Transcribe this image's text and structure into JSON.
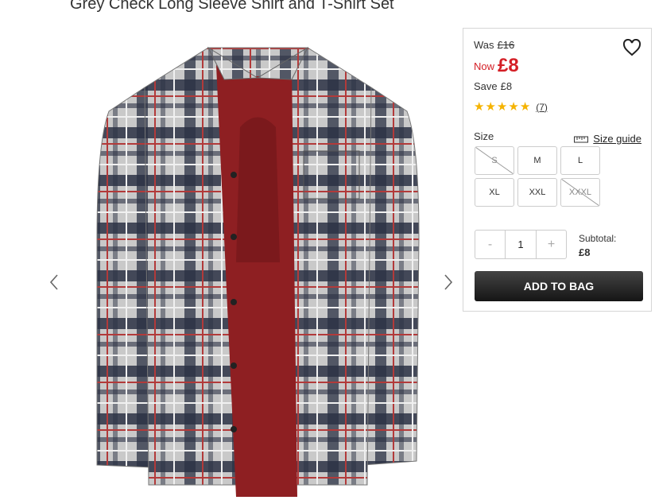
{
  "product": {
    "title": "Grey Check Long Sleeve Shirt and T-Shirt Set"
  },
  "gallery": {
    "prev_icon": "chevron-left-icon",
    "next_icon": "chevron-right-icon"
  },
  "price": {
    "was_label": "Was",
    "was_value": "£16",
    "now_label": "Now",
    "now_value": "£8",
    "save_label": "Save",
    "save_value": "£8",
    "accent_color": "#d41f26"
  },
  "rating": {
    "stars": 5,
    "max": 5,
    "reviews": "(7)",
    "star_color": "#f5b300"
  },
  "size": {
    "label": "Size",
    "guide_label": "Size guide",
    "options": [
      {
        "label": "S",
        "available": false
      },
      {
        "label": "M",
        "available": true
      },
      {
        "label": "L",
        "available": true
      },
      {
        "label": "XL",
        "available": true
      },
      {
        "label": "XXL",
        "available": true
      },
      {
        "label": "XXXL",
        "available": false
      }
    ]
  },
  "quantity": {
    "minus": "-",
    "value": "1",
    "plus": "+"
  },
  "subtotal": {
    "label": "Subtotal:",
    "value": "£8"
  },
  "cta": {
    "add_to_bag": "ADD TO BAG"
  }
}
